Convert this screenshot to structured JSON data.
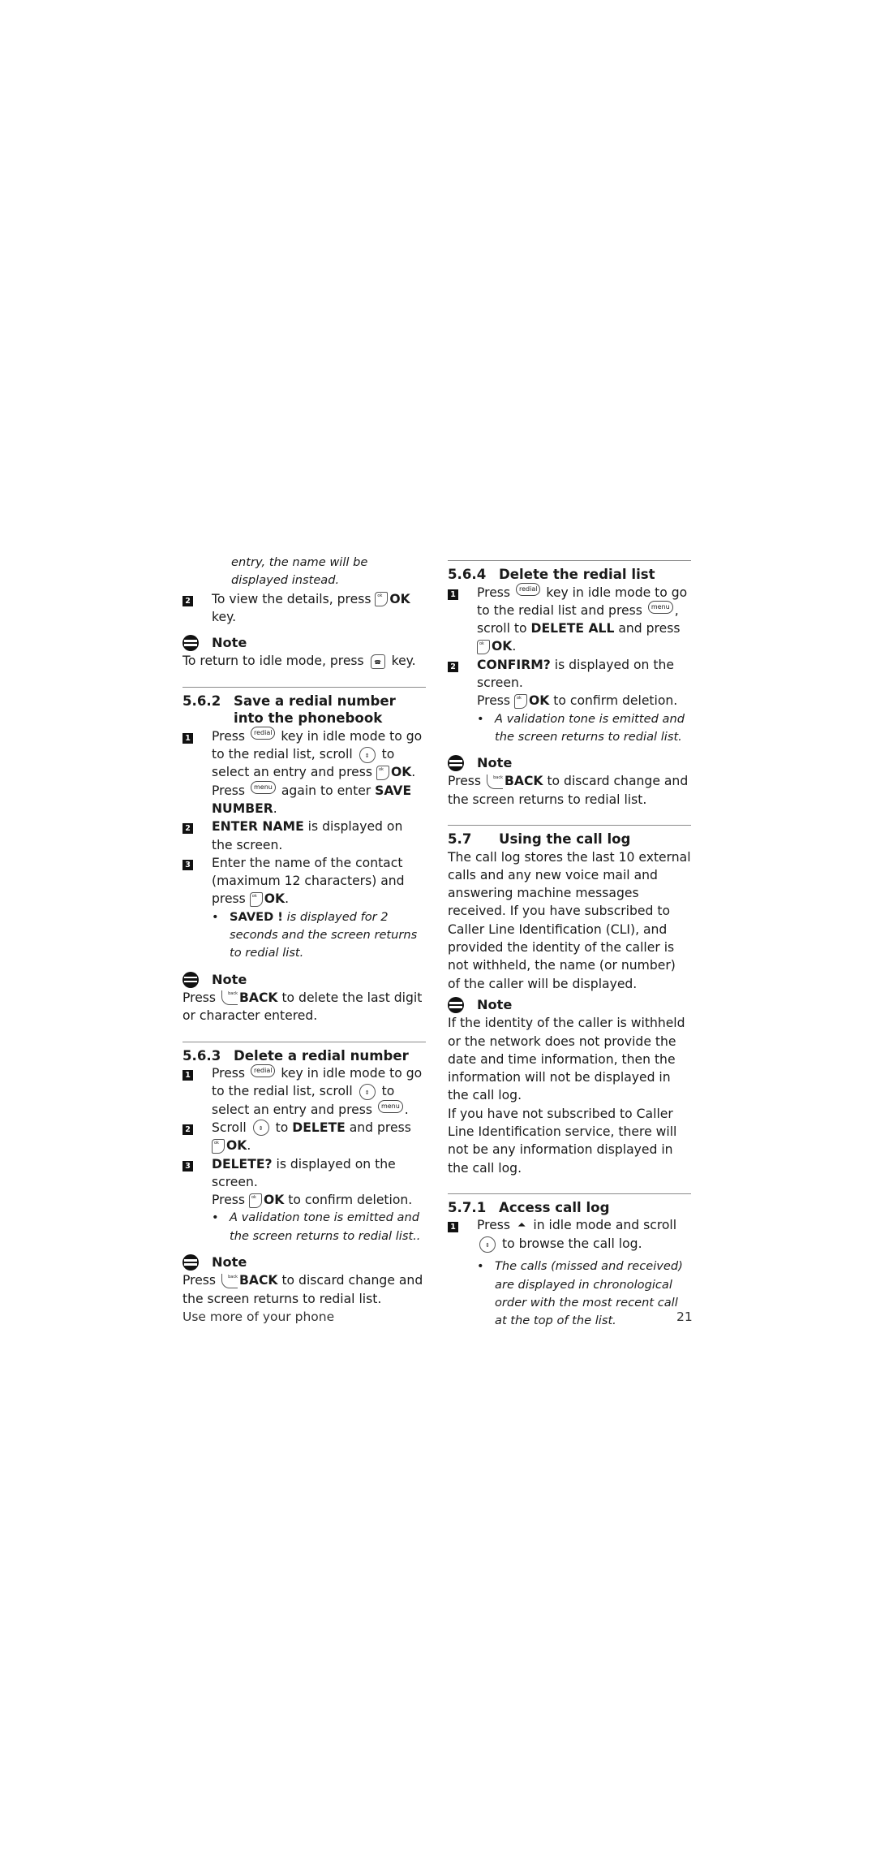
{
  "page": {
    "footer_section": "Use more of your phone",
    "page_number": "21"
  },
  "keys": {
    "redial": "redial",
    "menu": "menu",
    "ok": "OK",
    "back": "BACK",
    "ok_glyph": "ok",
    "back_glyph": "back",
    "scroll_glyph": "⇕",
    "end_glyph": "☎",
    "calllog_glyph": "⏶"
  },
  "left": {
    "cont_italic": "entry, the name will be displayed instead.",
    "step2_pre": "To view the details, press ",
    "step2_post": " key.",
    "note1_title": "Note",
    "note1_pre": "To return to idle mode, press ",
    "note1_post": " key.",
    "s562": {
      "num": "5.6.2",
      "title": "Save a redial number into the phonebook",
      "step1_a": "Press ",
      "step1_b": " key in idle mode to go to the redial list, scroll ",
      "step1_c": " to select an entry and press ",
      "step1_d": ". Press ",
      "step1_e": " again to enter ",
      "step1_bold": "SAVE NUMBER",
      "step1_f": ".",
      "step2_bold": "ENTER NAME",
      "step2_text": " is displayed on the screen.",
      "step3_text": "Enter the name of the contact (maximum 12 characters) and press ",
      "step3_end": ".",
      "bullet_bold": "SAVED !",
      "bullet_text": " is displayed for 2 seconds and the screen returns to redial list.",
      "note_title": "Note",
      "note_pre": "Press ",
      "note_post": " to delete the last digit or character entered."
    },
    "s563": {
      "num": "5.6.3",
      "title": "Delete a redial number",
      "step1_a": "Press ",
      "step1_b": " key in idle mode to go to the redial list, scroll ",
      "step1_c": " to select an entry and press ",
      "step1_d": ".",
      "step2_a": "Scroll ",
      "step2_b": " to ",
      "step2_bold": "DELETE",
      "step2_c": " and press ",
      "step2_d": ".",
      "step3_bold": "DELETE?",
      "step3_a": " is displayed on the screen.",
      "step3_b": "Press ",
      "step3_c": " to confirm deletion.",
      "bullet_text": "A validation tone is emitted and the screen returns to redial list..",
      "note_title": "Note",
      "note_pre": "Press ",
      "note_post": " to discard change and the screen returns to redial list."
    }
  },
  "right": {
    "s564": {
      "num": "5.6.4",
      "title": "Delete the redial list",
      "step1_a": "Press ",
      "step1_b": " key in idle mode to go to the redial list and press ",
      "step1_c": ", scroll to ",
      "step1_bold": "DELETE ALL",
      "step1_d": " and press ",
      "step1_e": ".",
      "step2_bold": "CONFIRM?",
      "step2_text": " is displayed on the screen.",
      "step2_b": "Press ",
      "step2_c": " to confirm deletion.",
      "bullet_text": "A validation tone is emitted and the screen returns to redial list.",
      "note_title": "Note",
      "note_pre": "Press ",
      "note_post": " to discard change and the screen returns to redial list."
    },
    "s57": {
      "num": "5.7",
      "title": "Using the call log",
      "body": "The call log stores the last 10 external calls and any new voice mail and answering machine messages received. If you have subscribed to Caller Line Identification (CLI), and provided the identity of the caller is not withheld, the name (or number) of the caller will be displayed.",
      "note_title": "Note",
      "note_p1": "If the identity of the caller is withheld or the network does not provide the date and time information, then the information will not be displayed in the call log.",
      "note_p2": "If you have not subscribed to Caller Line Identification service, there will not be any information displayed in the call log."
    },
    "s571": {
      "num": "5.7.1",
      "title": "Access call log",
      "step1_a": "Press ",
      "step1_b": " in idle mode and scroll ",
      "step1_c": " to browse the call log.",
      "bullet_text": "The calls (missed and received) are displayed in chronological order with the most recent call at the top of the list."
    }
  }
}
